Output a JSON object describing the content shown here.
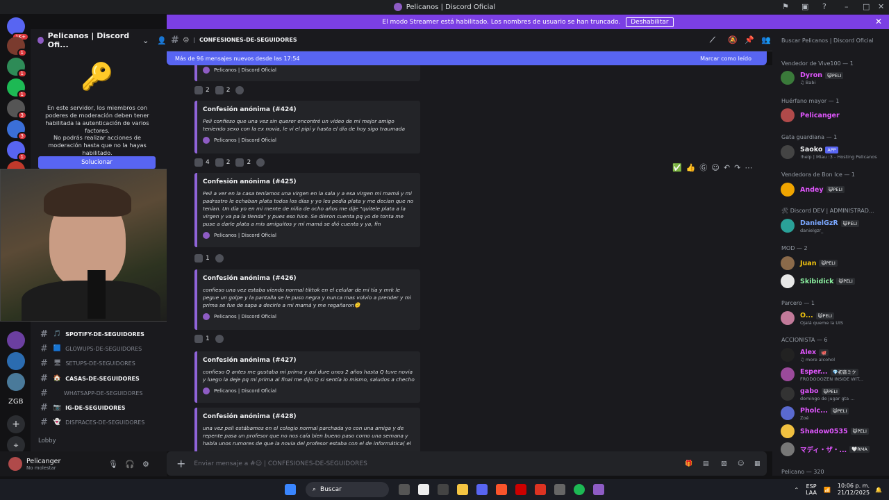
{
  "window": {
    "title": "Pelicanos | Discord Oficial"
  },
  "banner": {
    "text": "El modo Streamer está habilitado. Los nombres de usuario se han truncado.",
    "button": "Deshabilitar"
  },
  "guilds": {
    "badges": [
      "1K+",
      "1",
      "1",
      "1",
      "3",
      "3",
      "1",
      "3"
    ],
    "bottom_label": "ZGB",
    "bottom_badge": "11"
  },
  "server": {
    "name": "Pelicanos | Discord Ofi...",
    "mfa_notice": "En este servidor, los miembros con poderes de moderación deben tener habilitada la autenticación de varios factores.",
    "mfa_notice2": "No podrás realizar acciones de moderación hasta que no la hayas habilitado.",
    "fix_button": "Solucionar"
  },
  "channels": [
    {
      "name": "SPOTIFY-DE-SEGUIDORES",
      "icon": "🎵",
      "bold": true
    },
    {
      "name": "GLOWUPS-DE-SEGUIDORES",
      "icon": "🟦",
      "bold": false
    },
    {
      "name": "SETUPS-DE-SEGUIDORES",
      "icon": "🖥",
      "bold": false
    },
    {
      "name": "CASAS-DE-SEGUIDORES",
      "icon": "🏠",
      "bold": true
    },
    {
      "name": "WHATSAPP-DE-SEGUIDORES",
      "icon": "",
      "bold": false
    },
    {
      "name": "IG-DE-SEGUIDORES",
      "icon": "📷",
      "bold": true
    },
    {
      "name": "DISFRACES-DE-SEGUIDORES",
      "icon": "👻",
      "bold": false
    }
  ],
  "voice": {
    "lobby": "Lobby"
  },
  "user": {
    "name": "Pelicanger",
    "status": "No molestar"
  },
  "channel": {
    "name": "CONFESIONES-DE-SEGUIDORES",
    "emoji": "😐"
  },
  "new_messages": {
    "text": "Más de 96 mensajes nuevos desde las 17:54",
    "action": "Marcar como leído"
  },
  "messages": [
    {
      "title": "",
      "desc": "",
      "footer": "Pelicanos | Discord Oficial",
      "reacts": [
        "2",
        "2"
      ]
    },
    {
      "title": "Confesión anónima (#424)",
      "desc": "Peli confieso que una vez sin querer encontré un video de mi mejor amigo teniendo sexo con la ex novia, le vi el pipí y hasta el día de hoy sigo traumada",
      "footer": "Pelicanos | Discord Oficial",
      "reacts": [
        "4",
        "2",
        "2"
      ]
    },
    {
      "title": "Confesión anónima (#425)",
      "desc": "Peli a ver en la casa teníamos una virgen en la sala y a esa virgen mi mamá y mi padrastro le echaban plata todos los días y yo les pedía plata y me decían que no tenían. Un día yo en mi mente de niña de ocho años me dije \"quitele plata a la virgen y va pa la tienda\" y pues eso hice. Se dieron cuenta pq yo de tonta me puse a darle plata a mis amiguitos y mi mamá se dió cuenta y ya, fin",
      "footer": "Pelicanos | Discord Oficial",
      "reacts": [
        "1"
      ]
    },
    {
      "title": "Confesión anónima (#426)",
      "desc": "confieso una vez estaba viendo normal tiktok en el celular de mi tía y mrk le pegue un golpe y la pantalla se le puso negra y nunca mas volvio a prender y mi prima se fue de sapa a decirle a mi mamá y me regañaron🫠",
      "footer": "Pelicanos | Discord Oficial",
      "reacts": [
        "1"
      ]
    },
    {
      "title": "Confesión anónima (#427)",
      "desc": "confieso Q antes me gustaba mi prima y así dure unos 2 años hasta Q tuve novia y luego la deje pq mi prima al final me dijo Q si sentía lo mismo, saludos a checho",
      "footer": "Pelicanos | Discord Oficial",
      "reacts": []
    },
    {
      "title": "Confesión anónima (#428)",
      "desc": "una vez peli estábamos en el colegio normal parchada yo con una amiga y de repente pasa un profesor que no nos caía bien bueno paso como una semana y había unos rumores de que la novia del profesor estaba con el de informática( el",
      "footer": "",
      "reacts": []
    }
  ],
  "composer": {
    "placeholder": "Enviar mensaje a #😐 | CONFESIONES-DE-SEGUIDORES"
  },
  "members": {
    "search": "Buscar Pelicanos | Discord Oficial",
    "groups": [
      {
        "label": "Vendedor de Vive100 — 1",
        "members": [
          {
            "name": "Dyron",
            "tag": "😺PELI",
            "status": "♫ Babi",
            "color": "#e056fd"
          }
        ]
      },
      {
        "label": "Huérfano mayor — 1",
        "members": [
          {
            "name": "Pelicanger",
            "tag": "",
            "status": "",
            "color": "#e056fd"
          }
        ]
      },
      {
        "label": "Gata guardiana — 1",
        "members": [
          {
            "name": "Saoko",
            "tag": "APP",
            "status": "!help | Miau :3 - Hosting Pelicanos",
            "color": "#f2f3f5"
          }
        ]
      },
      {
        "label": "Vendedora de Bon Ice — 1",
        "members": [
          {
            "name": "Andey",
            "tag": "😺PELI",
            "status": "",
            "color": "#e056fd"
          }
        ]
      },
      {
        "label": "🛠 Discord DEV | ADMINISTRAD...",
        "members": [
          {
            "name": "DanielGzR",
            "tag": "😺PELI",
            "status": "danielgzr_",
            "color": "#7aa7ff"
          }
        ]
      },
      {
        "label": "MOD — 2",
        "members": [
          {
            "name": "Juan",
            "tag": "😺PELI",
            "status": "",
            "color": "#f1c40f"
          },
          {
            "name": "Skibidick",
            "tag": "😺PELI",
            "status": "",
            "color": "#8bf0a0"
          }
        ]
      },
      {
        "label": "Parcero — 1",
        "members": [
          {
            "name": "O...",
            "tag": "😺PELI",
            "status": "Ojalá queme la UIS",
            "color": "#f1c40f"
          }
        ]
      },
      {
        "label": "ACCIONISTA — 6",
        "members": [
          {
            "name": "Alex",
            "tag": "🐙",
            "status": "♫ more alcohol",
            "color": "#e056fd"
          },
          {
            "name": "Esper...",
            "tag": "💎初音ミク",
            "status": "FRODOOOZEN INSIDE WIT...",
            "color": "#e056fd"
          },
          {
            "name": "gabo",
            "tag": "😺PELI",
            "status": "domingo de jugar gta ...",
            "color": "#e056fd"
          },
          {
            "name": "Pholc...",
            "tag": "😺PELI",
            "status": "Zoé",
            "color": "#e056fd"
          },
          {
            "name": "Shadow0535",
            "tag": "😺PELI",
            "status": "",
            "color": "#e056fd"
          },
          {
            "name": "マディ・ザ・...",
            "tag": "🤍RMA",
            "status": "",
            "color": "#e056fd"
          }
        ]
      },
      {
        "label": "Pelicano — 320",
        "members": []
      }
    ]
  },
  "taskbar": {
    "search": "Buscar",
    "lang": "ESP\nLAA",
    "time": "10:06 p. m.",
    "date": "21/12/2025"
  },
  "colors": {
    "accent": "#5865f2",
    "streamer": "#7b3fe4",
    "embed_border": "#8f64d8"
  }
}
